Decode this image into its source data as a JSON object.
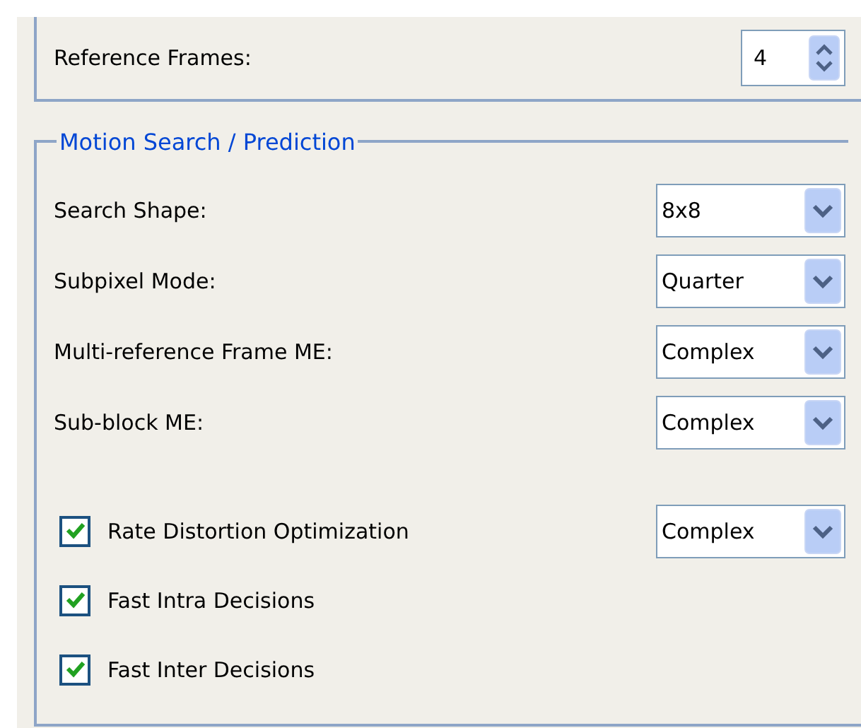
{
  "reference_frames": {
    "label": "Reference Frames:",
    "value": "4"
  },
  "motion_group": {
    "title": "Motion Search / Prediction",
    "rows": [
      {
        "kind": "select",
        "label": "Search Shape:",
        "value": "8x8"
      },
      {
        "kind": "select",
        "label": "Subpixel Mode:",
        "value": "Quarter"
      },
      {
        "kind": "select",
        "label": "Multi-reference Frame ME:",
        "value": "Complex"
      },
      {
        "kind": "select",
        "label": "Sub-block ME:",
        "value": "Complex"
      },
      {
        "kind": "checkbox",
        "label": "Rate Distortion Optimization",
        "checked": true,
        "value": "Complex"
      },
      {
        "kind": "checkbox",
        "label": "Fast Intra Decisions",
        "checked": true
      },
      {
        "kind": "checkbox",
        "label": "Fast Inter Decisions",
        "checked": true
      }
    ]
  }
}
